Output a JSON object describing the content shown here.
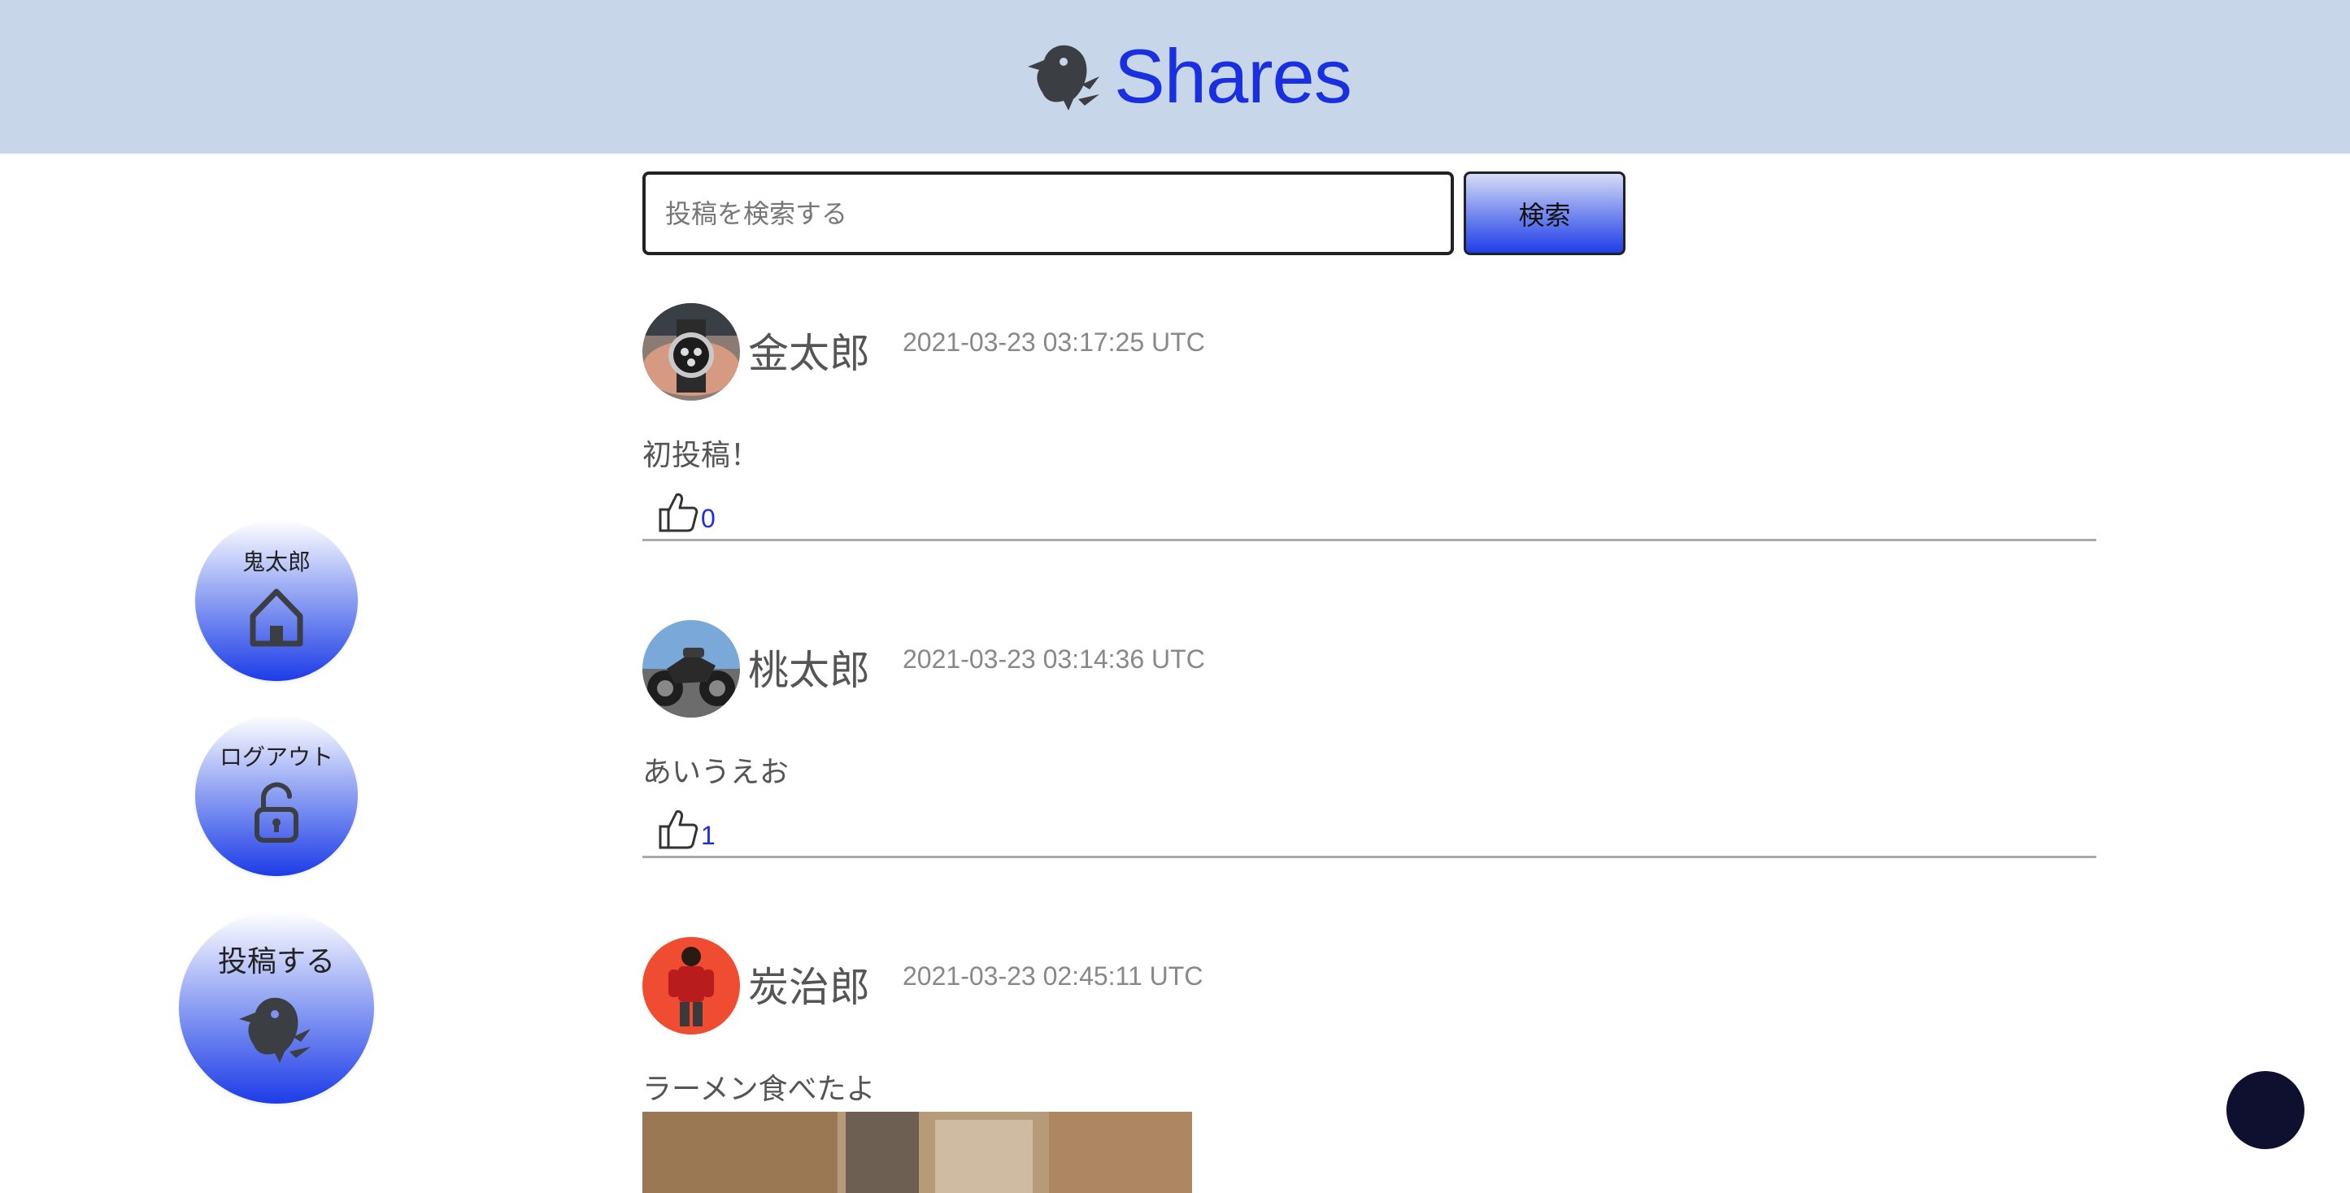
{
  "header": {
    "app_title": "Shares",
    "logo_icon": "bird-icon",
    "background_color": "#c8d6ea",
    "title_color": "#1a2fe0"
  },
  "search": {
    "placeholder": "投稿を検索する",
    "value": "",
    "button_label": "検索"
  },
  "sidebar": {
    "home": {
      "label": "鬼太郎",
      "icon": "home-icon"
    },
    "logout": {
      "label": "ログアウト",
      "icon": "unlock-icon"
    },
    "post": {
      "label": "投稿する",
      "icon": "bird-icon"
    }
  },
  "posts": [
    {
      "username": "金太郎",
      "timestamp": "2021-03-23 03:17:25 UTC",
      "body": "初投稿！",
      "like_count": "0",
      "avatar": "watch-avatar"
    },
    {
      "username": "桃太郎",
      "timestamp": "2021-03-23 03:14:36 UTC",
      "body": "あいうえお",
      "like_count": "1",
      "avatar": "motorcycle-avatar"
    },
    {
      "username": "炭治郎",
      "timestamp": "2021-03-23 02:45:11 UTC",
      "body": "ラーメン食べたよ",
      "like_count": "",
      "avatar": "character-avatar"
    }
  ],
  "colors": {
    "accent": "#1a2fe0",
    "fab": "#0f1030"
  }
}
